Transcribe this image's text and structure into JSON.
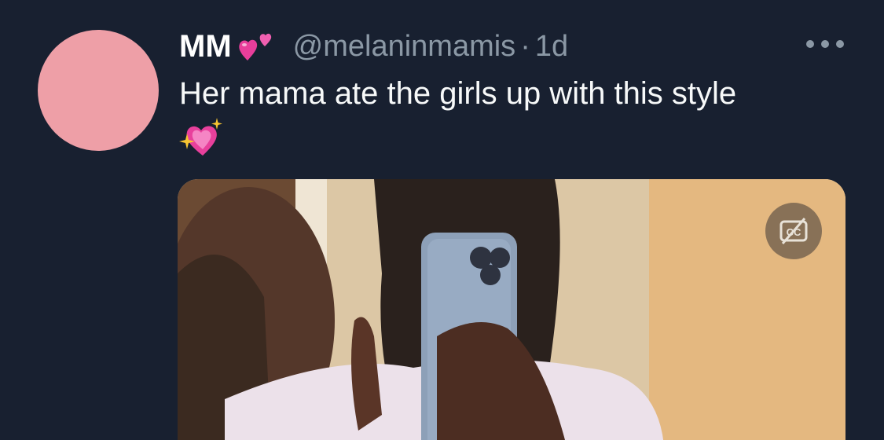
{
  "tweet": {
    "display_name": "MM",
    "name_emoji": "two-hearts-icon",
    "handle": "@melaninmamis",
    "separator": "·",
    "time": "1d",
    "text": "Her mama ate the girls up with this style",
    "text_emoji": "sparkling-heart-icon",
    "avatar_color": "#ee9fa7"
  },
  "media": {
    "type": "video",
    "captions_icon": "captions-off-icon"
  },
  "colors": {
    "background": "#182030",
    "primary_text": "#f7f9f9",
    "secondary_text": "#8b98a5"
  }
}
